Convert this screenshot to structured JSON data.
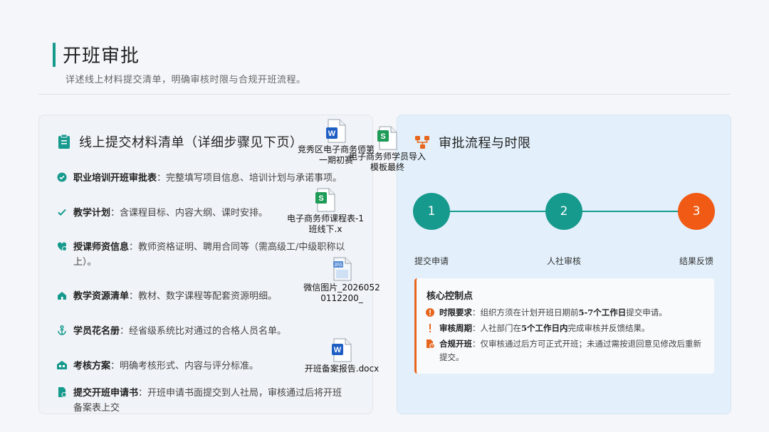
{
  "header": {
    "title": "开班审批",
    "subtitle": "详述线上材料提交清单，明确审核时限与合规开班流程。"
  },
  "left_card": {
    "title": "线上提交材料清单（详细步骤见下页）",
    "items": [
      {
        "key": "职业培训开班审批表",
        "text": "：完整填写项目信息、培训计划与承诺事项。"
      },
      {
        "key": "教学计划",
        "text": "：含课程目标、内容大纲、课时安排。"
      },
      {
        "key": "授课师资信息",
        "text": "：教师资格证明、聘用合同等（需高级工/中级职称以上）。"
      },
      {
        "key": "教学资源清单",
        "text": "：教材、数字课程等配套资源明细。"
      },
      {
        "key": "学员花名册",
        "text": "：经省级系统比对通过的合格人员名单。"
      },
      {
        "key": "考核方案",
        "text": "：明确考核形式、内容与评分标准。"
      },
      {
        "key": "提交开班申请书",
        "text": "：开班申请书面提交到人社局，审核通过后将开班备案表上交"
      }
    ]
  },
  "right_card": {
    "title": "审批流程与时限",
    "steps": [
      {
        "num": "1",
        "label": "提交申请"
      },
      {
        "num": "2",
        "label": "人社审核"
      },
      {
        "num": "3",
        "label": "结果反馈"
      }
    ],
    "control": {
      "title": "核心控制点",
      "rows": [
        {
          "key": "时限要求",
          "pre": "：组织方须在计划开班日期前",
          "bold": "5-7个工作日",
          "post": "提交申请。"
        },
        {
          "key": "审核周期",
          "pre": "：人社部门在",
          "bold": "5个工作日内",
          "post": "完成审核并反馈结果。"
        },
        {
          "key": "合规开班",
          "pre": "：仅审核通过后方可正式开班；未通过需按退回意见修改后重新提交。",
          "bold": "",
          "post": ""
        }
      ]
    }
  },
  "files": [
    {
      "name": "竞秀区电子商务师第一期初赛",
      "type": "word"
    },
    {
      "name": "电子商务师学员导入模板最终",
      "type": "sheet"
    },
    {
      "name": "电子商务师课程表-1班线下.x",
      "type": "sheet"
    },
    {
      "name": "微信图片_20260520112200_",
      "type": "image",
      "badge": "JPG"
    },
    {
      "name": "开班备案报告.docx",
      "type": "word"
    }
  ],
  "colors": {
    "accent": "#169a8d",
    "orange": "#e7661d",
    "step3": "#f05a14"
  }
}
